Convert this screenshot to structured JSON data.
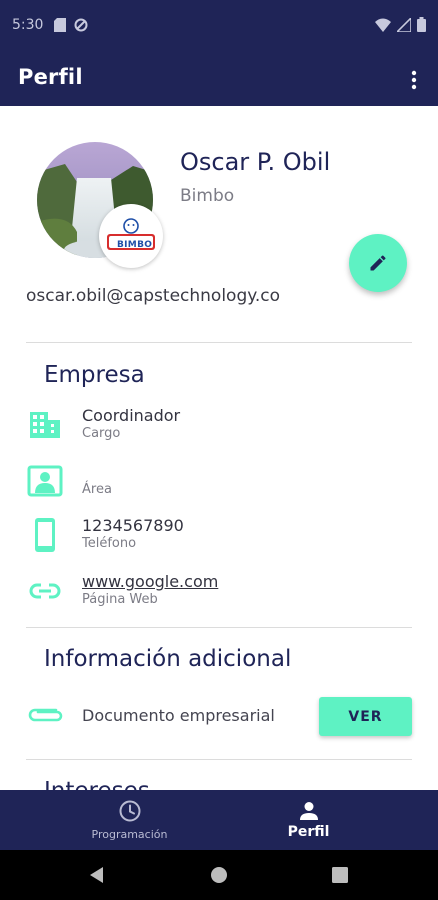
{
  "status_bar": {
    "time": "5:30"
  },
  "app_bar": {
    "title": "Perfil",
    "menu_icon": "more-vert-icon"
  },
  "profile": {
    "name": "Oscar P. Obil",
    "company": "Bimbo",
    "email": "oscar.obil@capstechnology.co",
    "logo_text": "BIMBO"
  },
  "empresa": {
    "title": "Empresa",
    "rows": [
      {
        "icon": "building-icon",
        "value": "Coordinador",
        "label": "Cargo"
      },
      {
        "icon": "id-card-icon",
        "value": "",
        "label": "Área"
      },
      {
        "icon": "phone-icon",
        "value": "1234567890",
        "label": "Teléfono"
      },
      {
        "icon": "link-icon",
        "value": "www.google.com",
        "label": "Página Web"
      }
    ]
  },
  "informacion": {
    "title": "Información adicional",
    "document_label": "Documento empresarial",
    "button_label": "VER"
  },
  "intereses": {
    "title": "Intereses"
  },
  "bottom_nav": {
    "items": [
      {
        "label": "Programación",
        "icon": "clock-icon",
        "active": false
      },
      {
        "label": "Perfil",
        "icon": "person-icon",
        "active": true
      }
    ]
  },
  "colors": {
    "primary": "#1f2457",
    "accent": "#5ef2c3",
    "text_secondary": "#7c7c86"
  }
}
